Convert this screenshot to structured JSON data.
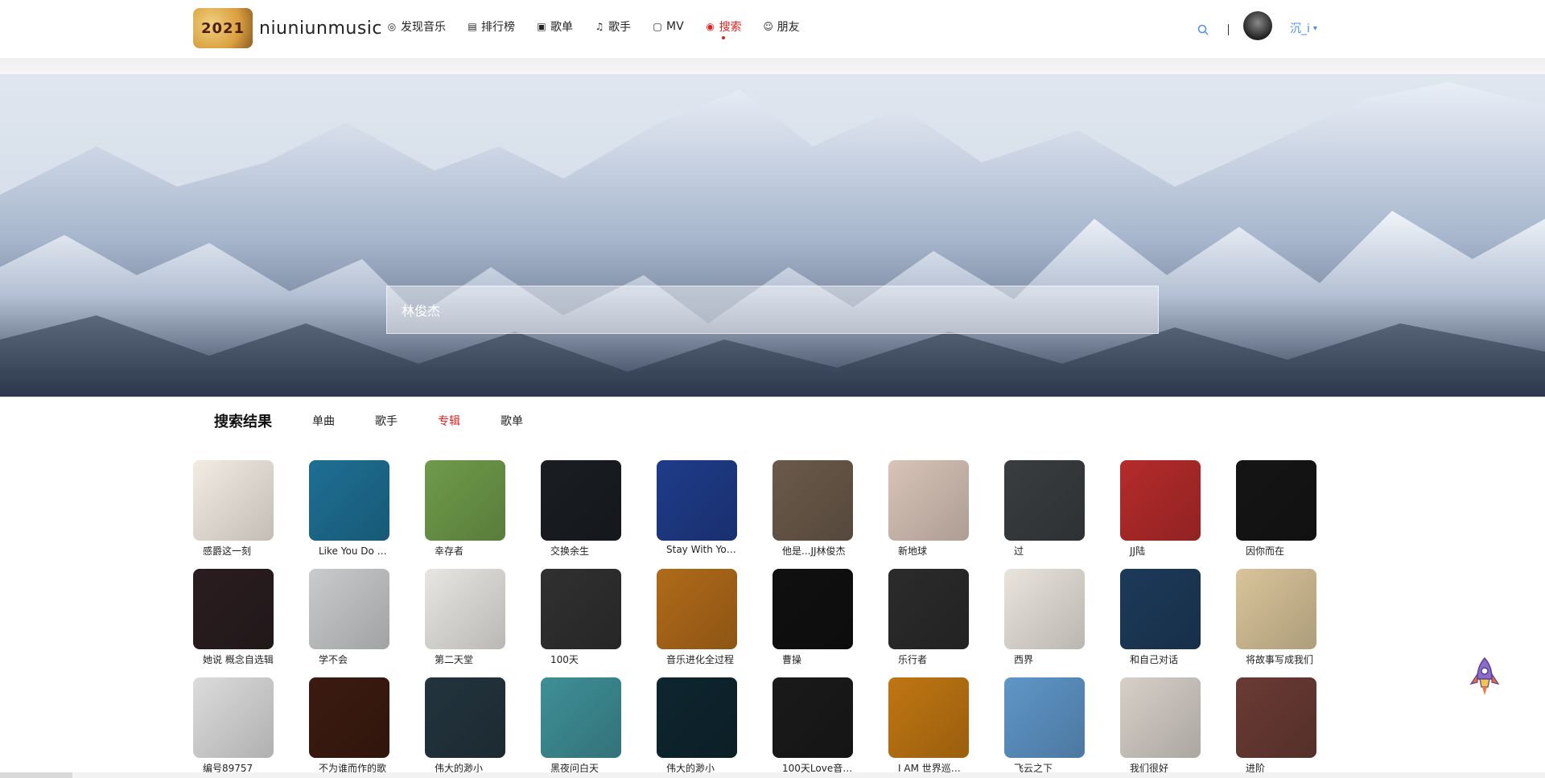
{
  "brand": {
    "logo_text": "2021",
    "name": "niuniunmusic"
  },
  "nav": [
    {
      "label": "发现音乐",
      "icon": "disc-icon",
      "glyph": "◎",
      "active": false
    },
    {
      "label": "排行榜",
      "icon": "chart-icon",
      "glyph": "▤",
      "active": false
    },
    {
      "label": "歌单",
      "icon": "playlist-icon",
      "glyph": "▣",
      "active": false
    },
    {
      "label": "歌手",
      "icon": "music-note-icon",
      "glyph": "♫",
      "active": false
    },
    {
      "label": "MV",
      "icon": "tv-icon",
      "glyph": "▢",
      "active": false
    },
    {
      "label": "搜索",
      "icon": "search-icon",
      "glyph": "◉",
      "active": true
    },
    {
      "label": "朋友",
      "icon": "friends-icon",
      "glyph": "☺",
      "active": false
    }
  ],
  "user": {
    "name": "沉_i"
  },
  "search": {
    "value": "林俊杰"
  },
  "results": {
    "title": "搜索结果",
    "tabs": [
      {
        "label": "单曲",
        "active": false
      },
      {
        "label": "歌手",
        "active": false
      },
      {
        "label": "专辑",
        "active": true
      },
      {
        "label": "歌单",
        "active": false
      }
    ],
    "albums": [
      {
        "title": "感爵这一刻",
        "color": "#f3ece3"
      },
      {
        "title": "Like You Do 如...",
        "color": "#1e6f94"
      },
      {
        "title": "幸存者",
        "color": "#6f9b4a"
      },
      {
        "title": "交换余生",
        "color": "#1a1d22"
      },
      {
        "title": "Stay With You...",
        "color": "#1f3c8a"
      },
      {
        "title": "他是...JJ林俊杰",
        "color": "#6b5a4b"
      },
      {
        "title": "新地球",
        "color": "#d8c4b8"
      },
      {
        "title": "过",
        "color": "#3a3d40"
      },
      {
        "title": "JJ陆",
        "color": "#b52b2b"
      },
      {
        "title": "因你而在",
        "color": "#151515"
      },
      {
        "title": "她说 概念自选辑",
        "color": "#2a1d20"
      },
      {
        "title": "学不会",
        "color": "#c9cbcc"
      },
      {
        "title": "第二天堂",
        "color": "#e8e6e2"
      },
      {
        "title": "100天",
        "color": "#303030"
      },
      {
        "title": "音乐进化全过程",
        "color": "#b06a1a"
      },
      {
        "title": "曹操",
        "color": "#101010"
      },
      {
        "title": "乐行者",
        "color": "#2b2b2b"
      },
      {
        "title": "西界",
        "color": "#e9e4dc"
      },
      {
        "title": "和自己对话",
        "color": "#1d3a5a"
      },
      {
        "title": "将故事写成我们",
        "color": "#d9c49a"
      },
      {
        "title": "编号89757",
        "color": "#dcdcdc"
      },
      {
        "title": "不为谁而作的歌",
        "color": "#3c1b10"
      },
      {
        "title": "伟大的渺小",
        "color": "#23343e"
      },
      {
        "title": "黑夜问白天",
        "color": "#3f8f97"
      },
      {
        "title": "伟大的渺小",
        "color": "#0e2630"
      },
      {
        "title": "100天Love音乐...",
        "color": "#1a1a1a"
      },
      {
        "title": "I AM 世界巡迴...",
        "color": "#c07612"
      },
      {
        "title": "飞云之下",
        "color": "#5f96c8"
      },
      {
        "title": "我们很好",
        "color": "#d6d0c8"
      },
      {
        "title": "进阶",
        "color": "#6a3b34"
      }
    ]
  }
}
